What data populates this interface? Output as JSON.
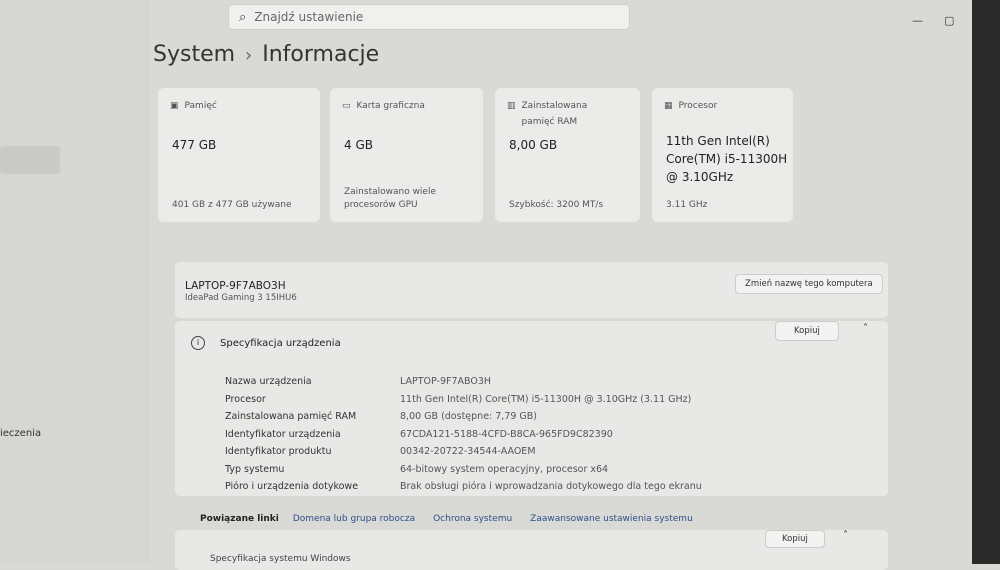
{
  "search": {
    "placeholder": "Znajdź ustawienie"
  },
  "window_controls": {
    "minimize": "—",
    "maximize": "▢",
    "close": "✕"
  },
  "breadcrumb": {
    "parent": "System",
    "separator": "›",
    "current": "Informacje"
  },
  "sidebar": {
    "partial_item": "ieczenia"
  },
  "cards": [
    {
      "icon": "storage-icon",
      "title": "Pamięć",
      "value": "477 GB",
      "sub": "401 GB z 477 GB używane"
    },
    {
      "icon": "gpu-icon",
      "title": "Karta graficzna",
      "value": "4 GB",
      "sub": "Zainstalowano wiele procesorów GPU"
    },
    {
      "icon": "ram-icon",
      "title": "Zainstalowana pamięć RAM",
      "value": "8,00 GB",
      "sub": "Szybkość: 3200 MT/s"
    },
    {
      "icon": "cpu-icon",
      "title": "Procesor",
      "value": "11th Gen Intel(R) Core(TM) i5-11300H @ 3.10GHz",
      "sub": "3.11 GHz"
    }
  ],
  "device": {
    "name": "LAPTOP-9F7ABO3H",
    "model": "IdeaPad Gaming 3 15IHU6",
    "rename_button": "Zmień nazwę tego komputera"
  },
  "specs": {
    "title": "Specyfikacja urządzenia",
    "copy_button": "Kopiuj",
    "rows": [
      {
        "k": "Nazwa urządzenia",
        "v": "LAPTOP-9F7ABO3H"
      },
      {
        "k": "Procesor",
        "v": "11th Gen Intel(R) Core(TM) i5-11300H @ 3.10GHz (3.11 GHz)"
      },
      {
        "k": "Zainstalowana pamięć RAM",
        "v": "8,00 GB (dostępne: 7,79 GB)"
      },
      {
        "k": "Identyfikator urządzenia",
        "v": "67CDA121-5188-4CFD-B8CA-965FD9C82390"
      },
      {
        "k": "Identyfikator produktu",
        "v": "00342-20722-34544-AAOEM"
      },
      {
        "k": "Typ systemu",
        "v": "64-bitowy system operacyjny, procesor x64"
      },
      {
        "k": "Pióro i urządzenia dotykowe",
        "v": "Brak obsługi pióra i wprowadzania dotykowego dla tego ekranu"
      }
    ]
  },
  "related": {
    "label": "Powiązane linki",
    "links": [
      "Domena lub grupa robocza",
      "Ochrona systemu",
      "Zaawansowane ustawienia systemu"
    ]
  },
  "windows_spec": {
    "title": "Specyfikacja systemu Windows",
    "copy_button": "Kopiuj"
  }
}
